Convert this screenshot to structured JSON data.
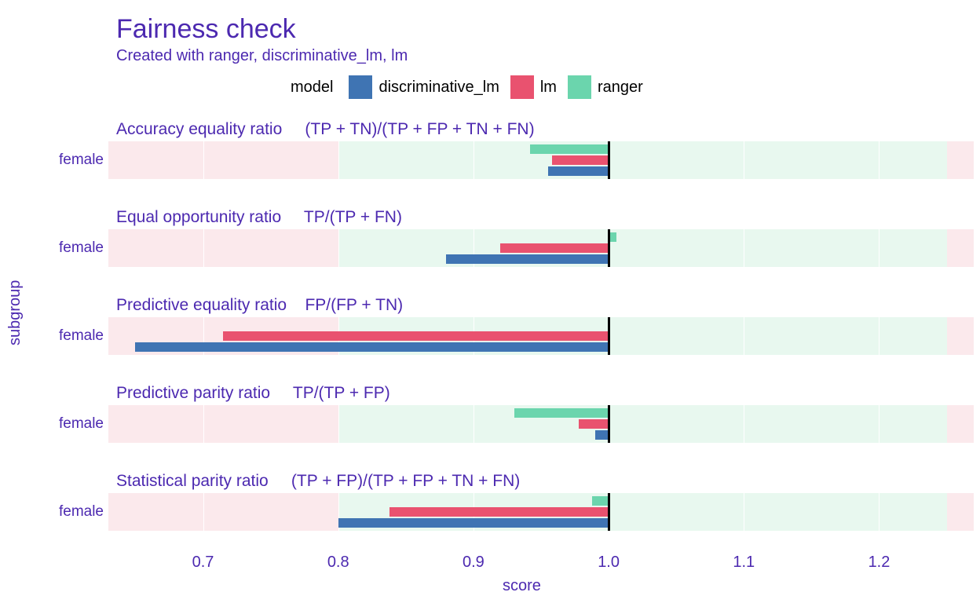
{
  "title": "Fairness check",
  "subtitle": "Created with ranger, discriminative_lm, lm",
  "legend_title": "model",
  "ylabel": "subgroup",
  "xlabel": "score",
  "colors": {
    "discriminative_lm": "#3f74b3",
    "lm": "#e9526f",
    "ranger": "#6bd5ad"
  },
  "legend_items": [
    {
      "key": "discriminative_lm",
      "label": "discriminative_lm"
    },
    {
      "key": "lm",
      "label": "lm"
    },
    {
      "key": "ranger",
      "label": "ranger"
    }
  ],
  "x_ticks": [
    0.7,
    0.8,
    0.9,
    1.0,
    1.1,
    1.2
  ],
  "chart_data": {
    "type": "bar",
    "x_range": [
      0.63,
      1.27
    ],
    "fair_zone": [
      0.8,
      1.25
    ],
    "reference": 1.0,
    "subgroup": "female",
    "facets": [
      {
        "title": "Accuracy equality ratio     (TP + TN)/(TP + FP + TN + FN)",
        "values": {
          "ranger": 0.942,
          "lm": 0.958,
          "discriminative_lm": 0.955
        }
      },
      {
        "title": "Equal opportunity ratio     TP/(TP + FN)",
        "values": {
          "ranger": 1.006,
          "lm": 0.92,
          "discriminative_lm": 0.88
        }
      },
      {
        "title": "Predictive equality ratio    FP/(FP + TN)",
        "values": {
          "ranger": 1.0,
          "lm": 0.715,
          "discriminative_lm": 0.65
        }
      },
      {
        "title": "Predictive parity ratio     TP/(TP + FP)",
        "values": {
          "ranger": 0.93,
          "lm": 0.978,
          "discriminative_lm": 0.99
        }
      },
      {
        "title": "Statistical parity ratio     (TP + FP)/(TP + FP + TN + FN)",
        "values": {
          "ranger": 0.988,
          "lm": 0.838,
          "discriminative_lm": 0.8
        }
      }
    ]
  }
}
